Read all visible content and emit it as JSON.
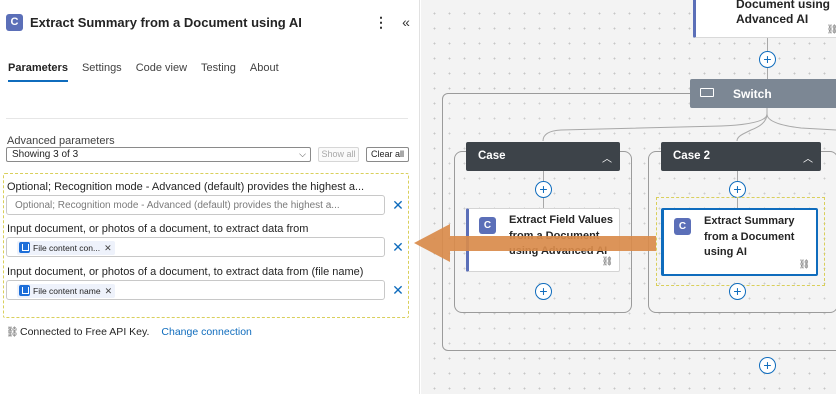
{
  "panel": {
    "title": "Extract Summary from a Document using AI",
    "icon_letter": "C",
    "more_icon": "more-vertical-icon",
    "collapse_icon": "chevron-double-left-icon",
    "tabs": [
      {
        "label": "Parameters",
        "active": true
      },
      {
        "label": "Settings",
        "active": false
      },
      {
        "label": "Code view",
        "active": false
      },
      {
        "label": "Testing",
        "active": false
      },
      {
        "label": "About",
        "active": false
      }
    ],
    "advanced": {
      "label": "Advanced parameters",
      "selected": "Showing 3 of 3",
      "show_all": "Show all",
      "clear_all": "Clear all"
    },
    "params": [
      {
        "label": "Optional; Recognition mode - Advanced (default) provides the highest a...",
        "placeholder": "Optional; Recognition mode - Advanced (default) provides the highest a..."
      },
      {
        "label": "Input document, or photos of a document, to extract data from",
        "token": "File content con..."
      },
      {
        "label": "Input document, or photos of a document, to extract data from (file name)",
        "token": "File content name"
      }
    ],
    "connection": {
      "text": "Connected to Free API Key.",
      "change": "Change connection"
    }
  },
  "canvas": {
    "top_card": {
      "line1": "Document using",
      "line2": "Advanced AI"
    },
    "switch": {
      "label": "Switch"
    },
    "cases": [
      {
        "label": "Case",
        "action": {
          "line1": "Extract Field Values",
          "line2": "from a Document",
          "line3": "using Advanced AI"
        }
      },
      {
        "label": "Case 2",
        "action": {
          "line1": "Extract Summary",
          "line2": "from a Document",
          "line3": "using AI"
        }
      }
    ]
  },
  "colors": {
    "accent": "#0f6cbd",
    "connector": "#5b6fb8",
    "case_header": "#3d4349",
    "switch_header": "#7c8794",
    "highlight_dash": "#d9cf5b",
    "arrow": "#d98b4b"
  }
}
